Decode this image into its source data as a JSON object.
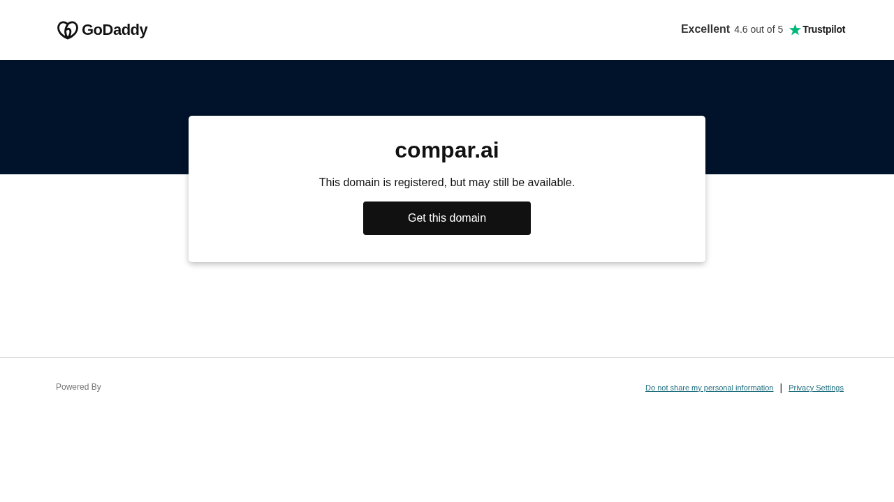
{
  "header": {
    "logo": "GoDaddy",
    "rating": {
      "label": "Excellent",
      "score": "4.6 out of 5",
      "brand": "Trustpilot"
    }
  },
  "card": {
    "domain": "compar.ai",
    "message": "This domain is registered, but may still be available.",
    "button": "Get this domain"
  },
  "footer": {
    "powered_by": "Powered By",
    "links": [
      "Do not share my personal information",
      "Privacy Settings"
    ],
    "separator": "|"
  }
}
